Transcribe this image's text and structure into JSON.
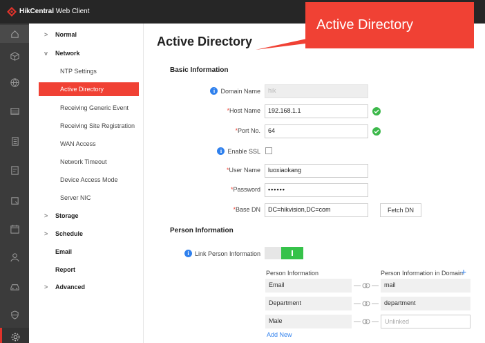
{
  "app": {
    "brand": "HikCentral",
    "suffix": "Web Client"
  },
  "rail_icons": [
    "home-icon",
    "cube-icon",
    "globe-icon",
    "monitor-icon",
    "building-icon",
    "card-icon",
    "screen-icon",
    "calendar-icon",
    "person-icon",
    "car-icon",
    "shield-icon",
    "gear-icon"
  ],
  "nav": {
    "items": [
      {
        "label": "Normal",
        "chev": ">",
        "type": "group"
      },
      {
        "label": "Network",
        "chev": "v",
        "type": "group"
      },
      {
        "label": "NTP Settings",
        "type": "sub"
      },
      {
        "label": "Active Directory",
        "type": "sub",
        "active": true
      },
      {
        "label": "Receiving Generic Event",
        "type": "sub"
      },
      {
        "label": "Receiving Site Registration",
        "type": "sub"
      },
      {
        "label": "WAN Access",
        "type": "sub"
      },
      {
        "label": "Network Timeout",
        "type": "sub"
      },
      {
        "label": "Device Access Mode",
        "type": "sub"
      },
      {
        "label": "Server NIC",
        "type": "sub"
      },
      {
        "label": "Storage",
        "chev": ">",
        "type": "group"
      },
      {
        "label": "Schedule",
        "chev": ">",
        "type": "group"
      },
      {
        "label": "Email",
        "type": "group"
      },
      {
        "label": "Report",
        "type": "group"
      },
      {
        "label": "Advanced",
        "chev": ">",
        "type": "group"
      }
    ]
  },
  "page": {
    "title": "Active Directory",
    "basic_title": "Basic Information",
    "person_title": "Person Information"
  },
  "form": {
    "domain_name": {
      "label": "Domain Name",
      "value": "hik"
    },
    "host_name": {
      "req": "*",
      "label": "Host Name",
      "value": "192.168.1.1"
    },
    "port_no": {
      "req": "*",
      "label": "Port No.",
      "value": "64"
    },
    "enable_ssl": {
      "label": "Enable SSL"
    },
    "user_name": {
      "req": "*",
      "label": "User Name",
      "value": "luoxiaokang"
    },
    "password": {
      "req": "*",
      "label": "Password",
      "value": "••••••"
    },
    "base_dn": {
      "req": "*",
      "label": "Base DN",
      "value": "DC=hikvision,DC=com",
      "button": "Fetch DN"
    },
    "link_person": {
      "label": "Link Person Information",
      "enabled": true
    }
  },
  "mapping": {
    "col_left": "Person Information",
    "col_right": "Person Information in Domain",
    "plus": "+",
    "rows": [
      {
        "left": "Email",
        "right": "mail"
      },
      {
        "left": "Department",
        "right": "department"
      },
      {
        "left": "Male",
        "right": "Unlinked"
      }
    ],
    "add_new": "Add New"
  },
  "callout": {
    "text": "Active Directory"
  },
  "colors": {
    "accent": "#f04134",
    "success": "#3cb84a",
    "link": "#2f80ed",
    "topbar": "#262626",
    "rail": "#3b3b3b"
  }
}
